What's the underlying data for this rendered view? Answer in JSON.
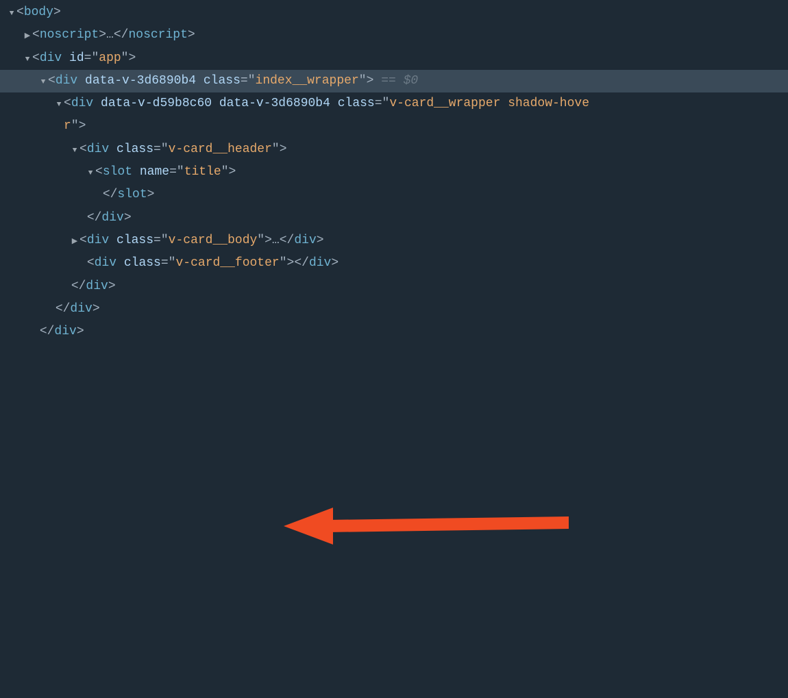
{
  "colors": {
    "bg": "#1e2a35",
    "selected_bg": "#3a4a58",
    "punct": "#a3b1bf",
    "tag": "#6fb3d2",
    "attr_name": "#b0d6f5",
    "attr_value": "#e6a96b",
    "dim": "#6c7a86",
    "annotation": "#f04b22"
  },
  "annotation": {
    "points_to_line": 8,
    "color": "#f04b22"
  },
  "lines": [
    {
      "indent": 0,
      "arrow": "down",
      "selected": false,
      "selectable": true,
      "tokens": [
        {
          "t": "punct",
          "v": "<"
        },
        {
          "t": "tag",
          "v": "body"
        },
        {
          "t": "punct",
          "v": ">"
        }
      ]
    },
    {
      "indent": 1,
      "arrow": "right",
      "selected": false,
      "selectable": true,
      "tokens": [
        {
          "t": "punct",
          "v": "<"
        },
        {
          "t": "tag",
          "v": "noscript"
        },
        {
          "t": "punct",
          "v": ">"
        },
        {
          "t": "ell",
          "v": "…"
        },
        {
          "t": "punct",
          "v": "</"
        },
        {
          "t": "tag",
          "v": "noscript"
        },
        {
          "t": "punct",
          "v": ">"
        }
      ]
    },
    {
      "indent": 1,
      "arrow": "down",
      "selected": false,
      "selectable": true,
      "tokens": [
        {
          "t": "punct",
          "v": "<"
        },
        {
          "t": "tag",
          "v": "div"
        },
        {
          "t": "space",
          "v": " "
        },
        {
          "t": "attrn",
          "v": "id"
        },
        {
          "t": "eq",
          "v": "="
        },
        {
          "t": "punct",
          "v": "\""
        },
        {
          "t": "attrv",
          "v": "app"
        },
        {
          "t": "punct",
          "v": "\""
        },
        {
          "t": "punct",
          "v": ">"
        }
      ]
    },
    {
      "indent": 2,
      "arrow": "down",
      "selected": true,
      "selectable": true,
      "tokens": [
        {
          "t": "punct",
          "v": "<"
        },
        {
          "t": "tag",
          "v": "div"
        },
        {
          "t": "space",
          "v": " "
        },
        {
          "t": "attrn",
          "v": "data-v-3d6890b4"
        },
        {
          "t": "space",
          "v": " "
        },
        {
          "t": "attrn",
          "v": "class"
        },
        {
          "t": "eq",
          "v": "="
        },
        {
          "t": "punct",
          "v": "\""
        },
        {
          "t": "attrv",
          "v": "index__wrapper"
        },
        {
          "t": "punct",
          "v": "\""
        },
        {
          "t": "punct",
          "v": ">"
        },
        {
          "t": "space",
          "v": " "
        },
        {
          "t": "dim",
          "v": "== $0"
        }
      ]
    },
    {
      "indent": 3,
      "arrow": "down",
      "selected": false,
      "selectable": true,
      "tokens": [
        {
          "t": "punct",
          "v": "<"
        },
        {
          "t": "tag",
          "v": "div"
        },
        {
          "t": "space",
          "v": " "
        },
        {
          "t": "attrn",
          "v": "data-v-d59b8c60"
        },
        {
          "t": "space",
          "v": " "
        },
        {
          "t": "attrn",
          "v": "data-v-3d6890b4"
        },
        {
          "t": "space",
          "v": " "
        },
        {
          "t": "attrn",
          "v": "class"
        },
        {
          "t": "eq",
          "v": "="
        },
        {
          "t": "punct",
          "v": "\""
        },
        {
          "t": "attrv",
          "v": "v-card__wrapper shadow-hove"
        }
      ]
    },
    {
      "indent": 3,
      "arrow": "blank",
      "selected": false,
      "selectable": true,
      "tokens": [
        {
          "t": "attrv",
          "v": "r"
        },
        {
          "t": "punct",
          "v": "\""
        },
        {
          "t": "punct",
          "v": ">"
        }
      ]
    },
    {
      "indent": 4,
      "arrow": "down",
      "selected": false,
      "selectable": true,
      "tokens": [
        {
          "t": "punct",
          "v": "<"
        },
        {
          "t": "tag",
          "v": "div"
        },
        {
          "t": "space",
          "v": " "
        },
        {
          "t": "attrn",
          "v": "class"
        },
        {
          "t": "eq",
          "v": "="
        },
        {
          "t": "punct",
          "v": "\""
        },
        {
          "t": "attrv",
          "v": "v-card__header"
        },
        {
          "t": "punct",
          "v": "\""
        },
        {
          "t": "punct",
          "v": ">"
        }
      ]
    },
    {
      "indent": 5,
      "arrow": "down",
      "selected": false,
      "selectable": true,
      "tokens": [
        {
          "t": "punct",
          "v": "<"
        },
        {
          "t": "tag",
          "v": "slot"
        },
        {
          "t": "space",
          "v": " "
        },
        {
          "t": "attrn",
          "v": "name"
        },
        {
          "t": "eq",
          "v": "="
        },
        {
          "t": "punct",
          "v": "\""
        },
        {
          "t": "attrv",
          "v": "title"
        },
        {
          "t": "punct",
          "v": "\""
        },
        {
          "t": "punct",
          "v": ">"
        }
      ]
    },
    {
      "indent": 5,
      "arrow": "blank",
      "selected": false,
      "selectable": true,
      "tokens": [
        {
          "t": "space",
          "v": " "
        },
        {
          "t": "punct",
          "v": "</"
        },
        {
          "t": "tag",
          "v": "slot"
        },
        {
          "t": "punct",
          "v": ">"
        }
      ]
    },
    {
      "indent": 4,
      "arrow": "blank",
      "selected": false,
      "selectable": true,
      "tokens": [
        {
          "t": "space",
          "v": " "
        },
        {
          "t": "punct",
          "v": "</"
        },
        {
          "t": "tag",
          "v": "div"
        },
        {
          "t": "punct",
          "v": ">"
        }
      ]
    },
    {
      "indent": 4,
      "arrow": "right",
      "selected": false,
      "selectable": true,
      "tokens": [
        {
          "t": "punct",
          "v": "<"
        },
        {
          "t": "tag",
          "v": "div"
        },
        {
          "t": "space",
          "v": " "
        },
        {
          "t": "attrn",
          "v": "class"
        },
        {
          "t": "eq",
          "v": "="
        },
        {
          "t": "punct",
          "v": "\""
        },
        {
          "t": "attrv",
          "v": "v-card__body"
        },
        {
          "t": "punct",
          "v": "\""
        },
        {
          "t": "punct",
          "v": ">"
        },
        {
          "t": "ell",
          "v": "…"
        },
        {
          "t": "punct",
          "v": "</"
        },
        {
          "t": "tag",
          "v": "div"
        },
        {
          "t": "punct",
          "v": ">"
        }
      ]
    },
    {
      "indent": 4,
      "arrow": "blank",
      "selected": false,
      "selectable": true,
      "tokens": [
        {
          "t": "space",
          "v": " "
        },
        {
          "t": "punct",
          "v": "<"
        },
        {
          "t": "tag",
          "v": "div"
        },
        {
          "t": "space",
          "v": " "
        },
        {
          "t": "attrn",
          "v": "class"
        },
        {
          "t": "eq",
          "v": "="
        },
        {
          "t": "punct",
          "v": "\""
        },
        {
          "t": "attrv",
          "v": "v-card__footer"
        },
        {
          "t": "punct",
          "v": "\""
        },
        {
          "t": "punct",
          "v": ">"
        },
        {
          "t": "punct",
          "v": "</"
        },
        {
          "t": "tag",
          "v": "div"
        },
        {
          "t": "punct",
          "v": ">"
        }
      ]
    },
    {
      "indent": 3,
      "arrow": "blank",
      "selected": false,
      "selectable": true,
      "tokens": [
        {
          "t": "space",
          "v": " "
        },
        {
          "t": "punct",
          "v": "</"
        },
        {
          "t": "tag",
          "v": "div"
        },
        {
          "t": "punct",
          "v": ">"
        }
      ]
    },
    {
      "indent": 2,
      "arrow": "blank",
      "selected": false,
      "selectable": true,
      "tokens": [
        {
          "t": "space",
          "v": " "
        },
        {
          "t": "punct",
          "v": "</"
        },
        {
          "t": "tag",
          "v": "div"
        },
        {
          "t": "punct",
          "v": ">"
        }
      ]
    },
    {
      "indent": 1,
      "arrow": "blank",
      "selected": false,
      "selectable": true,
      "tokens": [
        {
          "t": "space",
          "v": " "
        },
        {
          "t": "punct",
          "v": "</"
        },
        {
          "t": "tag",
          "v": "div"
        },
        {
          "t": "punct",
          "v": ">"
        }
      ]
    }
  ]
}
